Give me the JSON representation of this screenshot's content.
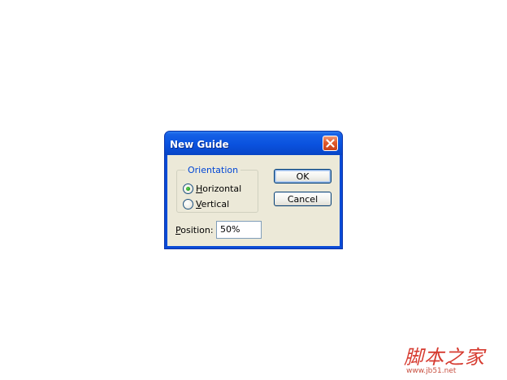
{
  "dialog": {
    "title": "New Guide",
    "close_icon": "close-x-icon",
    "orientation": {
      "legend": "Orientation",
      "options": [
        {
          "label": "Horizontal",
          "mnemonic": "H",
          "rest": "orizontal",
          "selected": true
        },
        {
          "label": "Vertical",
          "mnemonic": "V",
          "rest": "ertical",
          "selected": false
        }
      ]
    },
    "buttons": {
      "ok": "OK",
      "cancel": "Cancel"
    },
    "position": {
      "label_mnemonic": "P",
      "label_rest": "osition:",
      "value": "50%"
    }
  },
  "watermark": {
    "text": "脚本之家",
    "url": "www.jb51.net"
  },
  "colors": {
    "title_bar": "#0a52de",
    "close_button": "#e05a2c",
    "dialog_face": "#ece9d8",
    "legend_text": "#0046d5",
    "radio_selected": "#21a121",
    "watermark": "#d63a2f"
  }
}
